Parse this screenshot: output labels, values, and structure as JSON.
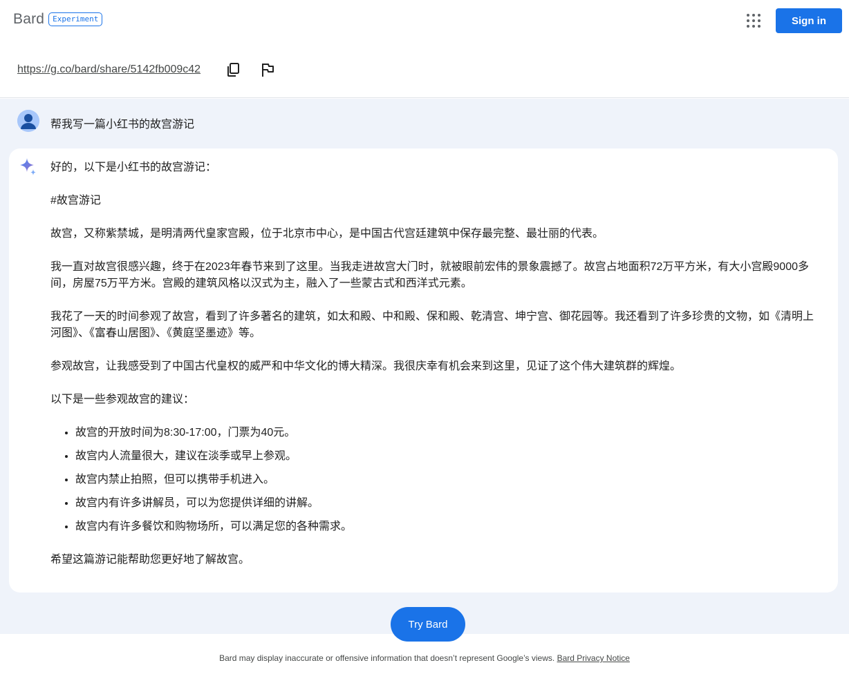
{
  "header": {
    "brand": "Bard",
    "badge": "Experiment",
    "apps_icon": "grid-apps-icon",
    "signin_label": "Sign in"
  },
  "share": {
    "url": "https://g.co/bard/share/5142fb009c42",
    "copy_icon": "copy-icon",
    "flag_icon": "flag-icon"
  },
  "conversation": {
    "prompt": "帮我写一篇小红书的故宫游记",
    "response": {
      "intro": "好的，以下是小红书的故宫游记：",
      "hashtag": "#故宫游记",
      "paragraphs": [
        "故宫，又称紫禁城，是明清两代皇家宫殿，位于北京市中心，是中国古代宫廷建筑中保存最完整、最壮丽的代表。",
        "我一直对故宫很感兴趣，终于在2023年春节来到了这里。当我走进故宫大门时，就被眼前宏伟的景象震撼了。故宫占地面积72万平方米，有大小宫殿9000多间，房屋75万平方米。宫殿的建筑风格以汉式为主，融入了一些蒙古式和西洋式元素。",
        "我花了一天的时间参观了故宫，看到了许多著名的建筑，如太和殿、中和殿、保和殿、乾清宫、坤宁宫、御花园等。我还看到了许多珍贵的文物，如《清明上河图》、《富春山居图》、《黄庭坚墨迹》等。",
        "参观故宫，让我感受到了中国古代皇权的威严和中华文化的博大精深。我很庆幸有机会来到这里，见证了这个伟大建筑群的辉煌。"
      ],
      "tips_heading": "以下是一些参观故宫的建议：",
      "tips": [
        "故宫的开放时间为8:30-17:00，门票为40元。",
        "故宫内人流量很大，建议在淡季或早上参观。",
        "故宫内禁止拍照，但可以携带手机进入。",
        "故宫内有许多讲解员，可以为您提供详细的讲解。",
        "故宫内有许多餐饮和购物场所，可以满足您的各种需求。"
      ],
      "closing": "希望这篇游记能帮助您更好地了解故宫。"
    },
    "try_label": "Try Bard"
  },
  "footer": {
    "text": "Bard may display inaccurate or offensive information that doesn’t represent Google’s views.",
    "link": "Bard Privacy Notice"
  },
  "colors": {
    "accent": "#1a73e8",
    "conversation_bg": "#eff3fa",
    "card_bg": "#ffffff"
  }
}
